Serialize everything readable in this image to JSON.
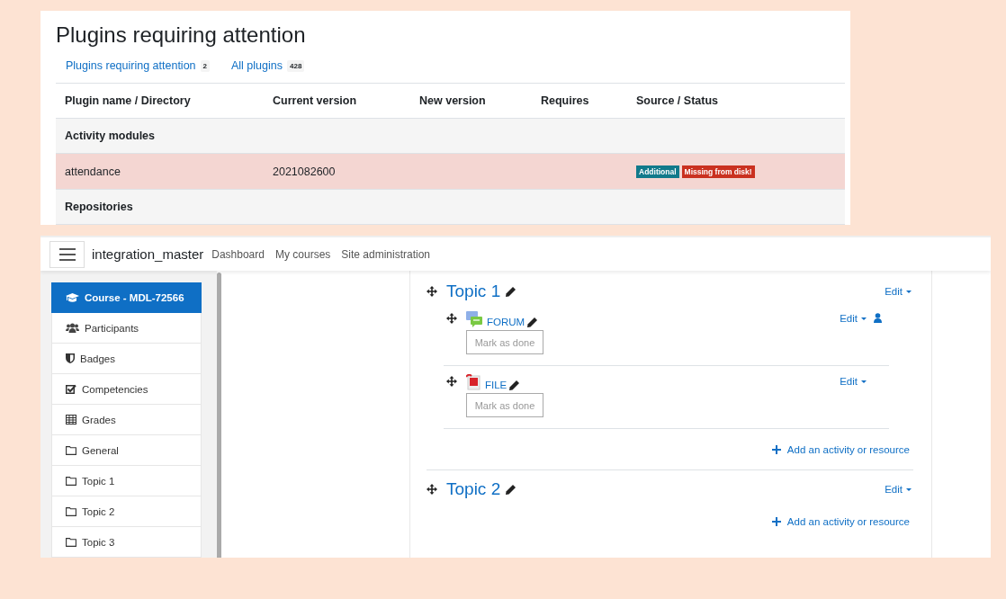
{
  "plugins_panel": {
    "title": "Plugins requiring attention",
    "tabs": [
      {
        "label": "Plugins requiring attention",
        "count": "2"
      },
      {
        "label": "All plugins",
        "count": "428"
      }
    ],
    "table": {
      "columns": [
        "Plugin name / Directory",
        "Current version",
        "New version",
        "Requires",
        "Source / Status"
      ],
      "rows": [
        {
          "kind": "category",
          "name": "Activity modules"
        },
        {
          "kind": "plugin",
          "name": "attendance",
          "current_version": "2021082600",
          "badges": [
            {
              "label": "Additional",
              "color": "#117a8b"
            },
            {
              "label": "Missing from disk!",
              "color": "#ca3120"
            }
          ]
        },
        {
          "kind": "category",
          "name": "Repositories"
        }
      ]
    }
  },
  "navbar": {
    "site_name": "integration_master",
    "links": [
      "Dashboard",
      "My courses",
      "Site administration"
    ]
  },
  "sidebar": {
    "items": [
      {
        "label": "Course - MDL-72566",
        "kind": "course",
        "selected": true
      },
      {
        "label": "Participants",
        "kind": "users",
        "selected": false
      },
      {
        "label": "Badges",
        "kind": "shield",
        "selected": false
      },
      {
        "label": "Competencies",
        "kind": "check",
        "selected": false
      },
      {
        "label": "Grades",
        "kind": "table",
        "selected": false
      },
      {
        "label": "General",
        "kind": "folder",
        "selected": false
      },
      {
        "label": "Topic 1",
        "kind": "folder",
        "selected": false
      },
      {
        "label": "Topic 2",
        "kind": "folder",
        "selected": false
      },
      {
        "label": "Topic 3",
        "kind": "folder",
        "selected": false
      }
    ]
  },
  "sections": [
    {
      "title": "Topic 1",
      "edit": "Edit",
      "modules": [
        {
          "name": "FORUM",
          "kind": "forum",
          "edit": "Edit",
          "group_mode": true,
          "completion": "Mark as done"
        },
        {
          "name": "FILE",
          "kind": "file",
          "edit": "Edit",
          "group_mode": false,
          "completion": "Mark as done"
        }
      ],
      "add": "Add an activity or resource"
    },
    {
      "title": "Topic 2",
      "edit": "Edit",
      "add": "Add an activity or resource"
    }
  ]
}
